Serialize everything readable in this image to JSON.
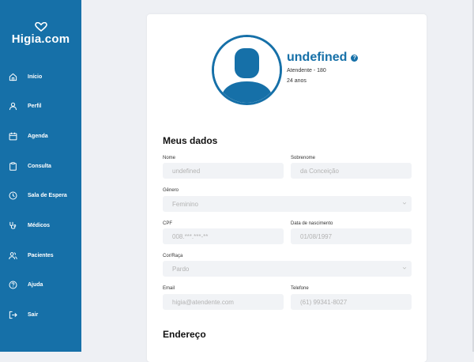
{
  "brand": {
    "name": "Higia.com"
  },
  "sidebar": {
    "items": [
      {
        "label": "Início",
        "icon": "home-icon"
      },
      {
        "label": "Perfil",
        "icon": "user-icon"
      },
      {
        "label": "Agenda",
        "icon": "calendar-icon"
      },
      {
        "label": "Consulta",
        "icon": "clipboard-icon"
      },
      {
        "label": "Sala de Espera",
        "icon": "clock-icon"
      },
      {
        "label": "Médicos",
        "icon": "stethoscope-icon"
      },
      {
        "label": "Pacientes",
        "icon": "users-icon"
      },
      {
        "label": "Ajuda",
        "icon": "help-circle-icon"
      },
      {
        "label": "Sair",
        "icon": "logout-icon"
      }
    ]
  },
  "profile": {
    "name": "undefined",
    "help_icon": "?",
    "role": "Atendente - 180",
    "age": "24 anos"
  },
  "meus_dados": {
    "title": "Meus dados",
    "nome_label": "Nome",
    "nome_value": "undefined",
    "sobrenome_label": "Sobrenome",
    "sobrenome_value": "da Conceição",
    "genero_label": "Gênero",
    "genero_value": "Feminino",
    "cpf_label": "CPF",
    "cpf_value": "008.***.***-**",
    "nascimento_label": "Data de nascimento",
    "nascimento_value": "01/08/1997",
    "cor_label": "Cor/Raça",
    "cor_value": "Pardo",
    "email_label": "Email",
    "email_value": "higia@atendente.com",
    "telefone_label": "Telefone",
    "telefone_value": "(61) 99341-8027"
  },
  "endereco": {
    "title": "Endereço"
  },
  "colors": {
    "primary": "#1670a8",
    "field_bg": "#f1f3f6",
    "page_bg": "#eef0f4"
  }
}
